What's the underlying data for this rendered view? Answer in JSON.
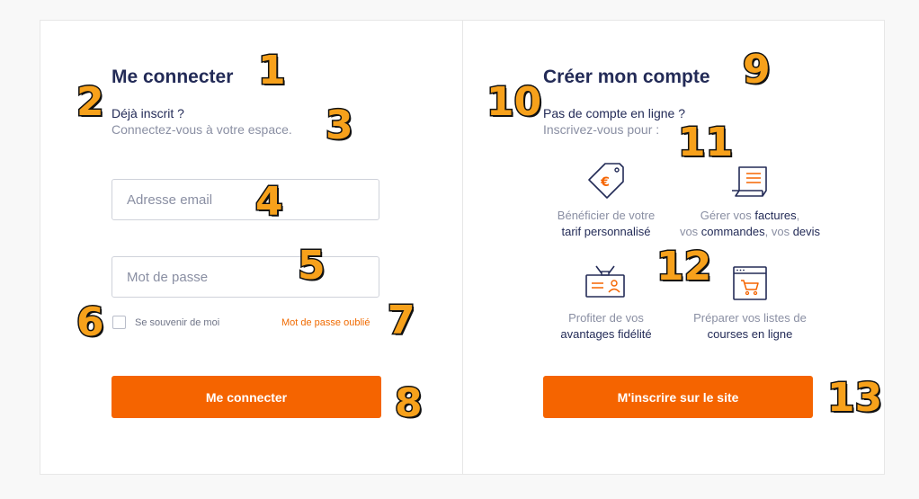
{
  "login": {
    "title": "Me connecter",
    "subtitle": "Déjà inscrit ?",
    "description": "Connectez-vous à votre espace.",
    "email_placeholder": "Adresse email",
    "password_placeholder": "Mot de passe",
    "remember_label": "Se souvenir de moi",
    "forgot_link": "Mot de passe oublié",
    "submit_label": "Me connecter"
  },
  "register": {
    "title": "Créer mon compte",
    "subtitle": "Pas de compte en ligne ?",
    "description": "Inscrivez-vous pour :",
    "features": [
      {
        "icon": "price-tag-euro-icon",
        "line1": "Bénéficier de votre",
        "line2_bold": "tarif personnalisé"
      },
      {
        "icon": "invoice-scroll-icon",
        "line1_prefix": "Gérer vos ",
        "line1_bold": "factures",
        "line1_suffix": ",",
        "line2_prefix": "vos ",
        "line2_bold1": "commandes",
        "line2_mid": ", vos ",
        "line2_bold2": "devis"
      },
      {
        "icon": "loyalty-card-icon",
        "line1": "Profiter de vos",
        "line2_bold": "avantages fidélité"
      },
      {
        "icon": "shopping-cart-window-icon",
        "line1": "Préparer vos listes de",
        "line2_bold": "courses en ligne"
      }
    ],
    "submit_label": "M'inscrire sur le site"
  },
  "annotations": [
    "1",
    "2",
    "3",
    "4",
    "5",
    "6",
    "7",
    "8",
    "9",
    "10",
    "11",
    "12",
    "13"
  ],
  "colors": {
    "accent": "#f56400",
    "navy": "#232b57",
    "grey": "#8a8fa3",
    "badge": "#f7a11b"
  }
}
